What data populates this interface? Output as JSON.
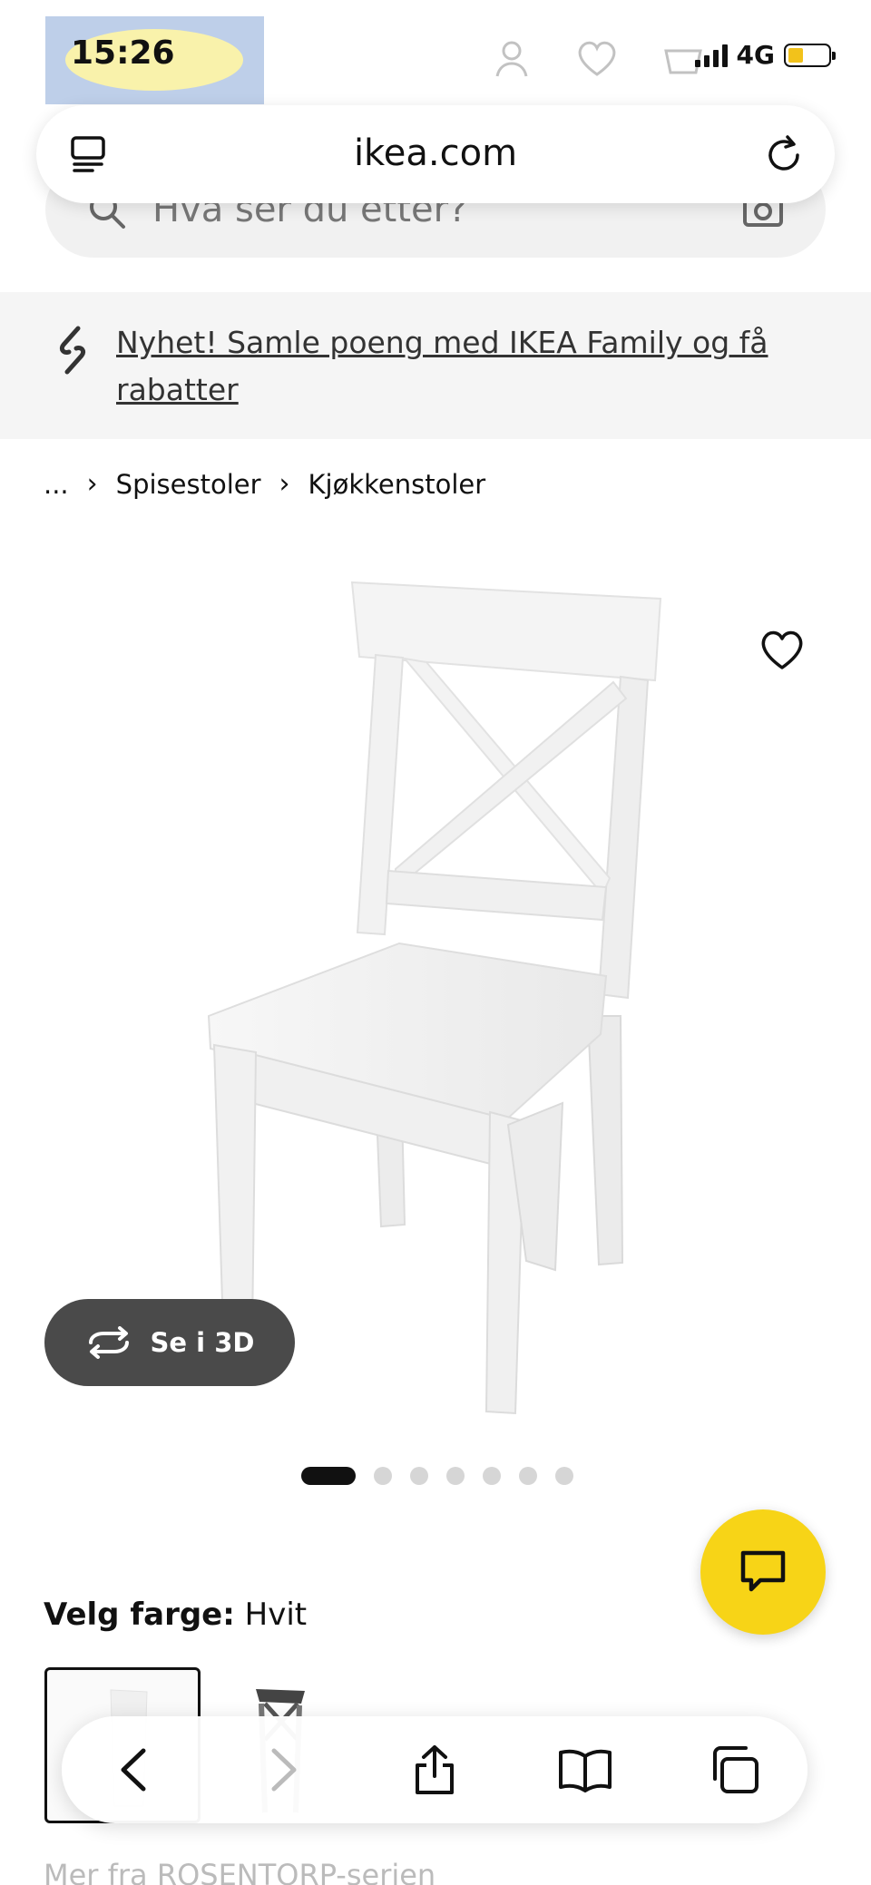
{
  "status_bar": {
    "time": "15:26",
    "network": "4G"
  },
  "browser": {
    "url": "ikea.com"
  },
  "search": {
    "placeholder": "Hva ser du etter?"
  },
  "promo": {
    "text": "Nyhet! Samle poeng med IKEA Family og få rabatter"
  },
  "breadcrumb": {
    "ellipsis": "...",
    "items": [
      "Spisestoler",
      "Kjøkkenstoler"
    ]
  },
  "product": {
    "view_3d_label": "Se i 3D",
    "image_count": 7,
    "active_image_index": 0
  },
  "color_picker": {
    "label": "Velg farge:",
    "value": "Hvit"
  },
  "series_link": "Mer fra ROSENTORP-serien",
  "colors": {
    "accent": "#f7d417",
    "dark_button": "#4a4a4a",
    "battery": "#f2c21b"
  }
}
